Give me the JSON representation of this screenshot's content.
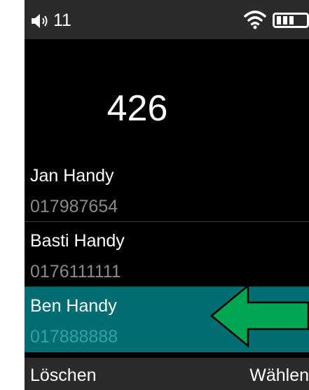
{
  "status_bar": {
    "speaker_icon": "speaker-icon",
    "volume": "11",
    "wifi_icon": "wifi-icon",
    "battery_icon": "battery-icon"
  },
  "dialer": {
    "number": "426"
  },
  "contacts": [
    {
      "name": "Jan Handy",
      "number": "017987654",
      "selected": false
    },
    {
      "name": "Basti Handy",
      "number": "0176111111",
      "selected": false
    },
    {
      "name": "Ben Handy",
      "number": "017888888",
      "selected": true
    }
  ],
  "annotation": {
    "icon": "green-arrow-left-icon",
    "color": "#00a651"
  },
  "softkeys": {
    "left_label": "Löschen",
    "right_label": "Wählen"
  },
  "colors": {
    "selected_row": "#006d73",
    "secondary_text": "#8a8a8a",
    "status_bar": "#2b2b2b"
  }
}
